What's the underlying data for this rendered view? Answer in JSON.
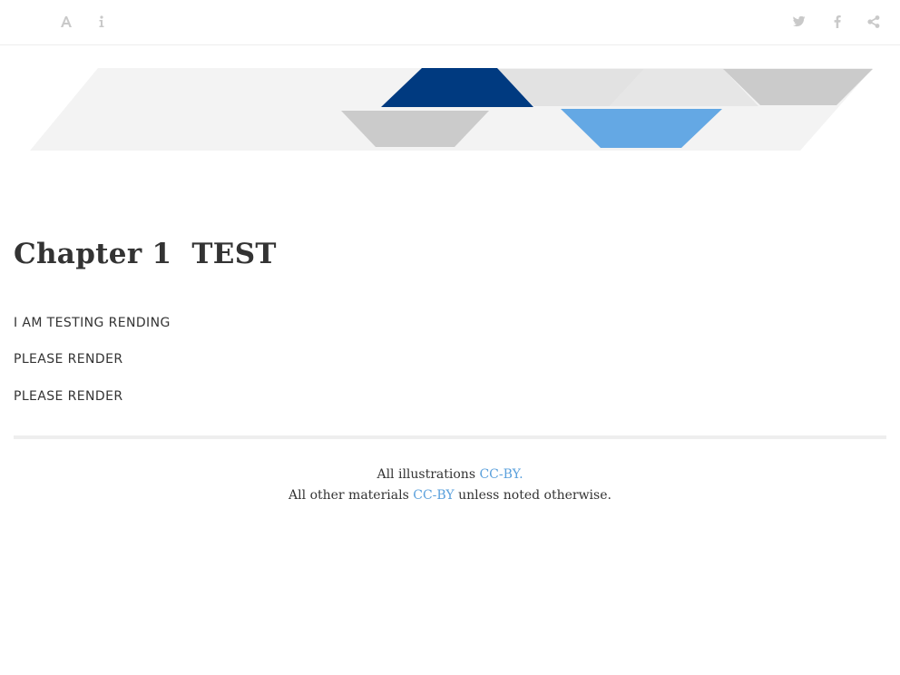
{
  "toolbar": {
    "left_icons": [
      "font-icon",
      "info-icon"
    ],
    "right_icons": [
      "twitter-icon",
      "facebook-icon",
      "share-icon"
    ]
  },
  "colors": {
    "dark_blue": "#003a80",
    "light_blue": "#64a8e4",
    "gray": "#cbcbcb",
    "light_gray": "#f3f3f3",
    "link": "#5aa0dc",
    "text": "#333333"
  },
  "chapter": {
    "number": "Chapter 1",
    "title": "TEST"
  },
  "paragraphs": [
    "I AM TESTING RENDING",
    "PLEASE RENDER",
    "PLEASE RENDER"
  ],
  "footer": {
    "line1_text": "All illustrations ",
    "line1_link": "CC-BY.",
    "line2_text": "All other materials ",
    "line2_link": "CC-BY",
    "line2_suffix": " unless noted otherwise."
  }
}
